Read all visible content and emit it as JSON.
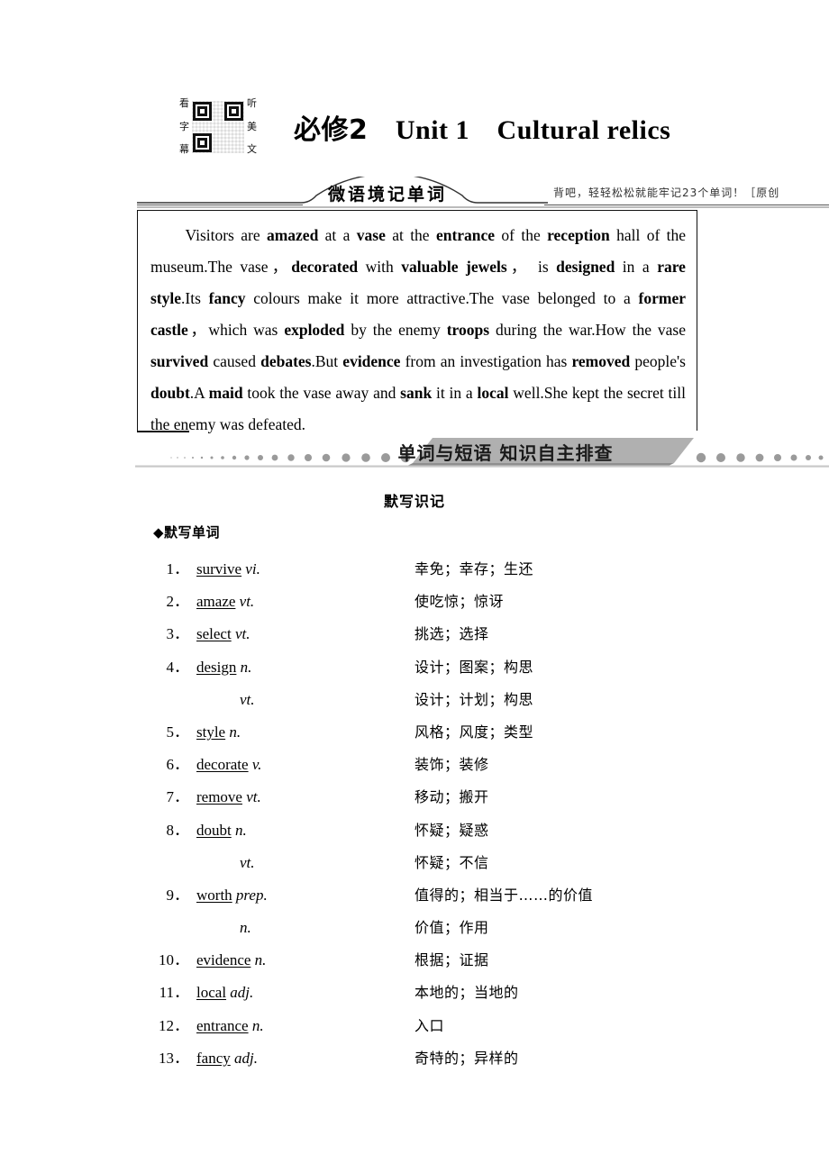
{
  "header": {
    "qr": {
      "left_chars": [
        "看",
        "字",
        "幕"
      ],
      "right_chars": [
        "听",
        "美",
        "文"
      ],
      "icon": "qr-code-icon"
    },
    "title_cn": "必修2",
    "title_en": "Unit 1 Cultural relics"
  },
  "banner1": {
    "label": "微语境记单词",
    "note": "背吧，轻轻松松就能牢记23个单词！［原创"
  },
  "passage": {
    "segments": [
      {
        "t": "Visitors are ",
        "b": false
      },
      {
        "t": "amazed",
        "b": true
      },
      {
        "t": " at a ",
        "b": false
      },
      {
        "t": "vase",
        "b": true
      },
      {
        "t": " at the ",
        "b": false
      },
      {
        "t": "entrance",
        "b": true
      },
      {
        "t": " of the ",
        "b": false
      },
      {
        "t": "reception",
        "b": true
      },
      {
        "t": " hall of the museum.The vase，",
        "b": false
      },
      {
        "t": "decorated",
        "b": true
      },
      {
        "t": " with ",
        "b": false
      },
      {
        "t": "valuable jewels",
        "b": true
      },
      {
        "t": "， is ",
        "b": false
      },
      {
        "t": "designed",
        "b": true
      },
      {
        "t": " in a ",
        "b": false
      },
      {
        "t": "rare style",
        "b": true
      },
      {
        "t": ".Its ",
        "b": false
      },
      {
        "t": "fancy",
        "b": true
      },
      {
        "t": " colours make it more attractive.The vase belonged to a ",
        "b": false
      },
      {
        "t": "former castle",
        "b": true
      },
      {
        "t": "，which was ",
        "b": false
      },
      {
        "t": "exploded",
        "b": true
      },
      {
        "t": " by the enemy ",
        "b": false
      },
      {
        "t": "troops",
        "b": true
      },
      {
        "t": " during the war.How the vase ",
        "b": false
      },
      {
        "t": "survived",
        "b": true
      },
      {
        "t": " caused ",
        "b": false
      },
      {
        "t": "debates",
        "b": true
      },
      {
        "t": ".But ",
        "b": false
      },
      {
        "t": "evidence",
        "b": true
      },
      {
        "t": " from an investigation has ",
        "b": false
      },
      {
        "t": "removed",
        "b": true
      },
      {
        "t": " people's ",
        "b": false
      },
      {
        "t": "doubt",
        "b": true
      },
      {
        "t": ".A ",
        "b": false
      },
      {
        "t": "maid",
        "b": true
      },
      {
        "t": " took the vase away and ",
        "b": false
      },
      {
        "t": "sank",
        "b": true
      },
      {
        "t": " it in a ",
        "b": false
      },
      {
        "t": "local",
        "b": true
      },
      {
        "t": " well.She kept the secret till the enemy was defeated.",
        "b": false
      }
    ]
  },
  "banner2": {
    "label": "单词与短语 知识自主排查"
  },
  "section": {
    "subtitle": "默写识记",
    "group_head": "◆默写单词"
  },
  "words": [
    {
      "num": "1．",
      "term": "survive",
      "pos": "vi.",
      "mean": "幸免；幸存；生还"
    },
    {
      "num": "2．",
      "term": "amaze",
      "pos": "vt.",
      "mean": "使吃惊；惊讶"
    },
    {
      "num": "3．",
      "term": "select",
      "pos": "vt.",
      "mean": "挑选；选择"
    },
    {
      "num": "4．",
      "term": "design",
      "pos": "n.",
      "mean": "设计；图案；构思"
    },
    {
      "num": "",
      "term": "",
      "pos": "vt.",
      "mean": "设计；计划；构思"
    },
    {
      "num": "5．",
      "term": "style",
      "pos": "n.",
      "mean": "风格；风度；类型"
    },
    {
      "num": "6．",
      "term": "decorate",
      "pos": "v.",
      "mean": "装饰；装修"
    },
    {
      "num": "7．",
      "term": "remove",
      "pos": "vt.",
      "mean": "移动；搬开"
    },
    {
      "num": "8．",
      "term": "doubt",
      "pos": "n.",
      "mean": "怀疑；疑惑"
    },
    {
      "num": "",
      "term": "",
      "pos": "vt.",
      "mean": "怀疑；不信"
    },
    {
      "num": "9．",
      "term": "worth",
      "pos": "prep.",
      "mean": "值得的；相当于……的价值"
    },
    {
      "num": "",
      "term": "",
      "pos": "n.",
      "mean": "价值；作用"
    },
    {
      "num": "10．",
      "term": "evidence",
      "pos": "n.",
      "mean": "根据；证据"
    },
    {
      "num": "11．",
      "term": "local",
      "pos": "adj.",
      "mean": "本地的；当地的"
    },
    {
      "num": "12．",
      "term": "entrance",
      "pos": "n.",
      "mean": "入口"
    },
    {
      "num": "13．",
      "term": "fancy",
      "pos": "adj.",
      "mean": "奇特的；异样的"
    }
  ],
  "colors": {
    "banner_gray": "#a8a8a8",
    "ink": "#000000",
    "rule": "#555555"
  }
}
